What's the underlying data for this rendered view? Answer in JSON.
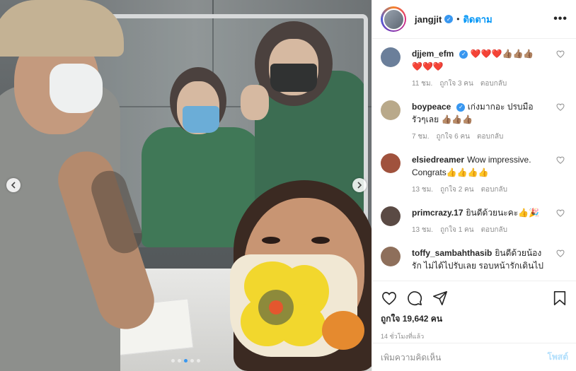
{
  "photo": {
    "alt": "",
    "carousel": {
      "total": 5,
      "active": 3
    }
  },
  "header": {
    "username": "jangjit",
    "follow_label": "ติดตาม",
    "separator": "•",
    "more": "•••",
    "verified_mark": "✓"
  },
  "comments": [
    {
      "username": "djjem_efm",
      "verified": true,
      "text": "❤️❤️❤️👍🏽👍🏽👍🏽 ❤️❤️❤️",
      "time": "11 ชม.",
      "likes": "ถูกใจ 3 คน",
      "reply": "ตอบกลับ",
      "avatar_color": "#6b7f9a"
    },
    {
      "username": "boypeace",
      "verified": true,
      "text": "เก่งมากอะ ปรบมือรัวๆเลย 👍🏽👍🏽👍🏽",
      "time": "7 ชม.",
      "likes": "ถูกใจ 6 คน",
      "reply": "ตอบกลับ",
      "avatar_color": "#b9a98a"
    },
    {
      "username": "elsiedreamer",
      "verified": false,
      "text": "Wow impressive. Congrats👍👍👍👍",
      "time": "13 ชม.",
      "likes": "ถูกใจ 2 คน",
      "reply": "ตอบกลับ",
      "avatar_color": "#a0523d"
    },
    {
      "username": "primcrazy.17",
      "verified": false,
      "text": "ยินดีด้วยนะคะ👍🎉",
      "time": "13 ชม.",
      "likes": "ถูกใจ 1 คน",
      "reply": "ตอบกลับ",
      "avatar_color": "#5a4a44"
    },
    {
      "username": "toffy_sambahthasib",
      "verified": false,
      "text": "ยินดีด้วยน้องรัก ไม่ได้ไปรับเลย รอบหน้ารักเดินไป",
      "time": "",
      "likes": "",
      "reply": "",
      "avatar_color": "#8e6f5b"
    }
  ],
  "actions": {
    "likes": "ถูกใจ 19,642 คน",
    "time": "14 ชั่วโมงที่แล้ว"
  },
  "composer": {
    "placeholder": "เพิ่มความคิดเห็น",
    "post_label": "โพสต์"
  },
  "colors": {
    "link": "#0095f6",
    "muted": "#8e8e8e",
    "post_disabled": "#b2dffc"
  }
}
